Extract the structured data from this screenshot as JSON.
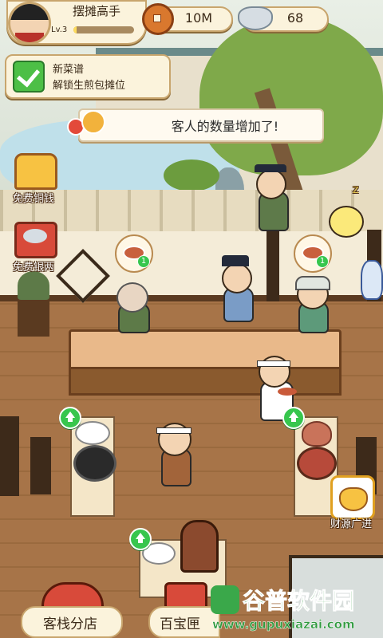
{
  "player": {
    "name": "摆摊高手",
    "level": "Lv.3",
    "xp_progress": 0.05
  },
  "currency": {
    "copper": {
      "value": "10M",
      "icon": "copper-coin-icon"
    },
    "silver": {
      "value": "68",
      "icon": "silver-ingot-icon"
    }
  },
  "quest": {
    "title": "新菜谱",
    "desc": "解锁生煎包摊位"
  },
  "notice": {
    "text": "客人的数量增加了!"
  },
  "side_left": [
    {
      "label": "免费铜钱",
      "icon": "treasure-chest-icon"
    },
    {
      "label": "免费银两",
      "icon": "silver-gift-box-icon"
    }
  ],
  "side_right": {
    "label": "财源广进",
    "icon": "gold-pot-icon"
  },
  "order_badges": [
    "1",
    "1"
  ],
  "bottom_nav": [
    {
      "label": "客栈分店",
      "icon": "inn-gate-icon"
    },
    {
      "label": "百宝匣",
      "icon": "treasure-box-icon"
    }
  ],
  "watermark": {
    "title": "谷普软件园",
    "url": "www.gupuxiazai.com"
  },
  "colors": {
    "accent": "#37c64d",
    "panel": "#fbf3dc",
    "wood": "#9a6a3e",
    "border": "#c8a56d"
  }
}
